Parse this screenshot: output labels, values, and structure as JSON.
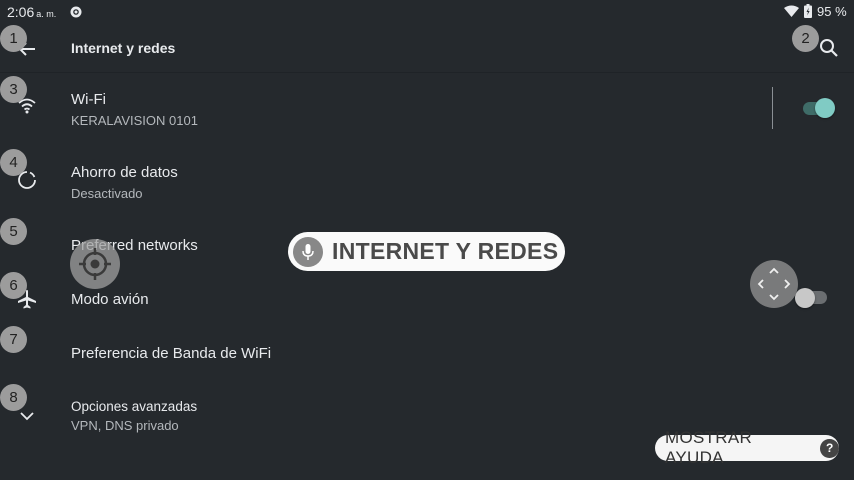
{
  "status_bar": {
    "time": "2:06",
    "ampm": "a. m.",
    "battery": "95 %"
  },
  "toolbar": {
    "title": "Internet y redes"
  },
  "rows": [
    {
      "title": "Wi-Fi",
      "subtitle": "KERALAVISION 0101",
      "icon": "wifi-icon",
      "toggle": true
    },
    {
      "title": "Ahorro de datos",
      "subtitle": "Desactivado",
      "icon": "data-saver-icon"
    },
    {
      "title": "Preferred networks",
      "subtitle": ""
    },
    {
      "title": "Modo avión",
      "subtitle": "",
      "icon": "airplane-icon",
      "toggle": false
    },
    {
      "title": "Preferencia de Banda de WiFi",
      "subtitle": ""
    },
    {
      "title": "Opciones avanzadas",
      "subtitle": "VPN, DNS privado",
      "icon": "chevron-down-icon"
    }
  ],
  "badges": [
    "1",
    "2",
    "3",
    "4",
    "5",
    "6",
    "7",
    "8"
  ],
  "voice_banner": {
    "text": "INTERNET Y REDES"
  },
  "help_button": {
    "label": "MOSTRAR AYUDA",
    "icon_text": "?"
  },
  "colors": {
    "background": "#25292d",
    "toggle_on_thumb": "#80cbc4",
    "toggle_on_track": "#3f6c68",
    "toggle_off_thumb": "#c8c8c8",
    "toggle_off_track": "#6b6e71"
  }
}
